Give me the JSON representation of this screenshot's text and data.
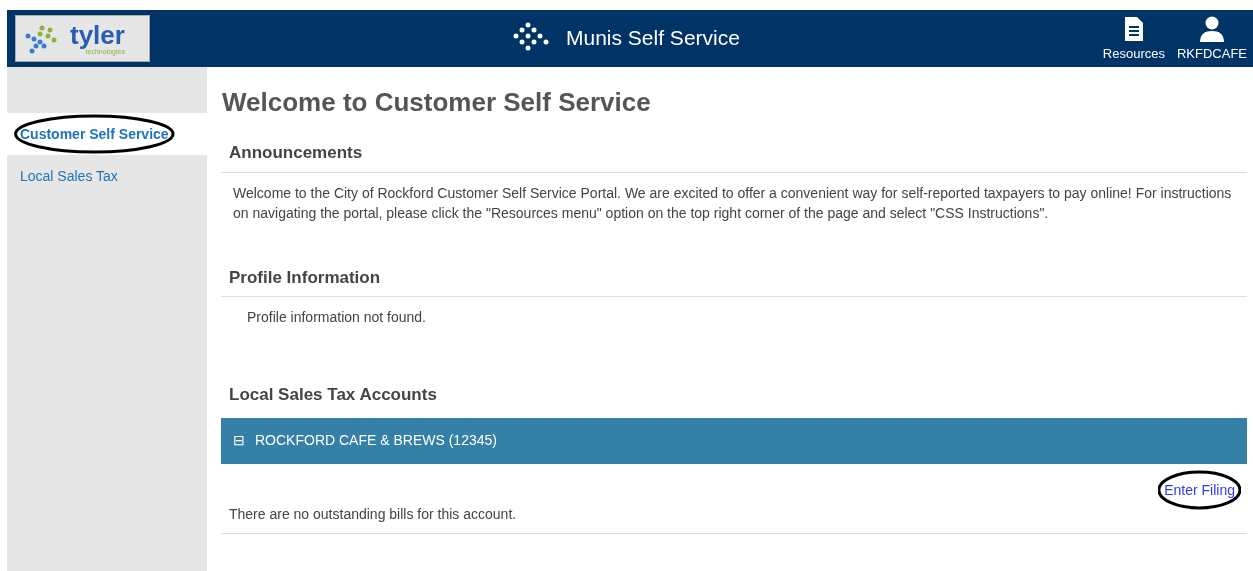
{
  "header": {
    "logo": {
      "word": "tyler",
      "tagline": "technologies"
    },
    "title": "Munis Self Service",
    "actions": [
      {
        "kind": "document",
        "label": "Resources"
      },
      {
        "kind": "user",
        "label": "RKFDCAFE"
      }
    ]
  },
  "sidebar": {
    "items": [
      {
        "label": "Customer Self Service",
        "selected": true,
        "circled": true
      },
      {
        "label": "Local Sales Tax",
        "selected": false,
        "circled": false
      }
    ]
  },
  "page_title": "Welcome to Customer Self Service",
  "sections": [
    {
      "heading": "Announcements",
      "text": "Welcome to the City of Rockford Customer Self Service Portal. We are excited to offer a convenient way for self-reported taxpayers to pay online! For instructions on navigating the portal, please click the \"Resources menu\" option on the top right corner of the page and select \"CSS Instructions\"."
    },
    {
      "heading": "Profile Information",
      "text": "Profile information not found."
    }
  ],
  "accounts": {
    "heading": "Local Sales Tax Accounts",
    "items": [
      {
        "toggle": "⊟",
        "name": "ROCKFORD CAFE & BREWS (12345)",
        "expanded": true,
        "link": {
          "label": "Enter Filing",
          "circled": true
        },
        "message": "There are no outstanding bills for this account."
      }
    ]
  }
}
